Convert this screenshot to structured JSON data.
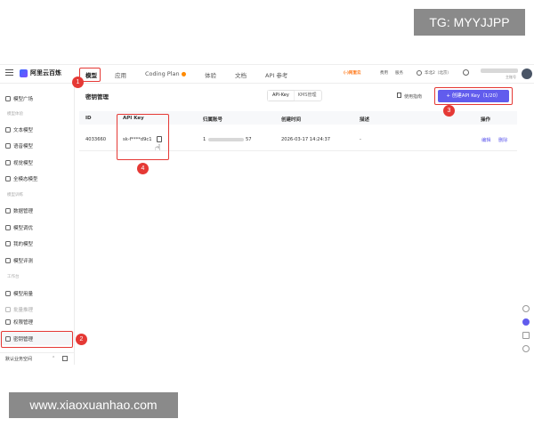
{
  "watermark_tg": "TG: MYYJJPP",
  "watermark_site": "www.xiaoxuanhao.com",
  "header": {
    "logo_text": "阿里云百炼",
    "tabs": [
      "模型",
      "应用",
      "Coding Plan",
      "体验",
      "文档",
      "API 参考"
    ],
    "right_items": [
      "(-)阿里云",
      "费用",
      "服务",
      "华北2（北京）"
    ],
    "account_suffix": "主账号"
  },
  "sidebar": {
    "top_item": "模型广场",
    "section_model_exp": "模型体验",
    "exp_items": [
      "文本模型",
      "语音模型",
      "视觉模型",
      "全模态模型"
    ],
    "section_model_train": "模型训练",
    "train_items": [
      "数据管理",
      "模型调优",
      "我的模型",
      "模型评测"
    ],
    "section_tools": "工作台",
    "tool_items": [
      "模型用量",
      "批量推理",
      "权限管理",
      "密钥管理"
    ],
    "footer": "默认业务空间"
  },
  "main": {
    "title": "密钥管理",
    "segment": [
      "API-Key",
      "KMS管理"
    ],
    "guide": "使用指南",
    "create_button": "+ 创建API Key（1/20）",
    "columns": [
      "ID",
      "API Key",
      "归属账号",
      "创建时间",
      "描述",
      "操作"
    ],
    "row": {
      "id": "4033660",
      "key": "sk-f****d9c1",
      "account_start": "1",
      "account_end": "57",
      "created": "2026-03-17 14:24:37",
      "desc": "-",
      "actions": [
        "编辑",
        "删除"
      ]
    }
  },
  "annotations": [
    "1",
    "2",
    "3",
    "4"
  ],
  "colors": {
    "accent": "#615ced",
    "annotation": "#e53935",
    "brand": "#ff6a00"
  }
}
